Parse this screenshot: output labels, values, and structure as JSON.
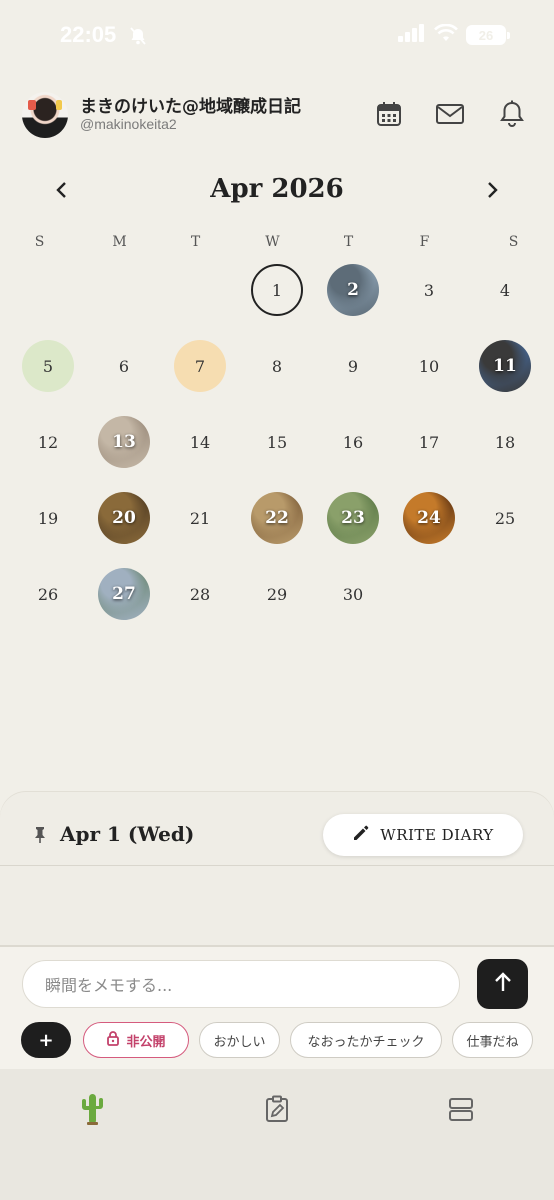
{
  "status_bar": {
    "time": "22:05",
    "battery": "26"
  },
  "profile": {
    "name": "まきのけいた@地域醸成日記",
    "handle": "@makinokeita2"
  },
  "calendar": {
    "month_title": "Apr 2026",
    "weekdays": [
      "S",
      "M",
      "T",
      "W",
      "T",
      "F",
      "S"
    ],
    "weeks": [
      [
        null,
        null,
        null,
        {
          "day": "1",
          "style": "today"
        },
        {
          "day": "2",
          "style": "photo",
          "photo_colors": [
            "#9fb6c9",
            "#5d6c78"
          ]
        },
        {
          "day": "3"
        },
        {
          "day": "4"
        }
      ],
      [
        {
          "day": "5",
          "style": "green"
        },
        {
          "day": "6"
        },
        {
          "day": "7",
          "style": "orange"
        },
        {
          "day": "8"
        },
        {
          "day": "9"
        },
        {
          "day": "10"
        },
        {
          "day": "11",
          "style": "photo",
          "photo_colors": [
            "#4a78b7",
            "#3a3a3a"
          ]
        }
      ],
      [
        {
          "day": "12"
        },
        {
          "day": "13",
          "style": "photo",
          "photo_colors": [
            "#8a7a6a",
            "#c4b7a6"
          ]
        },
        {
          "day": "14"
        },
        {
          "day": "15"
        },
        {
          "day": "16"
        },
        {
          "day": "17"
        },
        {
          "day": "18"
        }
      ],
      [
        {
          "day": "19"
        },
        {
          "day": "20",
          "style": "photo",
          "photo_colors": [
            "#3a2a1a",
            "#8a6a3a"
          ]
        },
        {
          "day": "21"
        },
        {
          "day": "22",
          "style": "photo",
          "photo_colors": [
            "#6a4a2a",
            "#b89a6a"
          ]
        },
        {
          "day": "23",
          "style": "photo",
          "photo_colors": [
            "#4a6a3a",
            "#8aa06a"
          ]
        },
        {
          "day": "24",
          "style": "photo",
          "photo_colors": [
            "#3a1a0a",
            "#c47a2a"
          ]
        },
        {
          "day": "25"
        }
      ],
      [
        {
          "day": "26"
        },
        {
          "day": "27",
          "style": "photo",
          "photo_colors": [
            "#5a7a5a",
            "#a0b0c0"
          ]
        },
        {
          "day": "28"
        },
        {
          "day": "29"
        },
        {
          "day": "30"
        },
        null,
        null
      ]
    ]
  },
  "selected": {
    "date_label": "Apr 1 (Wed)",
    "write_button": "WRITE DIARY"
  },
  "composer": {
    "placeholder": "瞬間をメモする...",
    "add_label": "+",
    "chips": [
      "非公開",
      "おかしい",
      "なおったかチェック",
      "仕事だね"
    ]
  },
  "colors": {
    "background": "#F1EFE8",
    "today_ring": "#222222",
    "green_mark": "#DCE8C9",
    "orange_mark": "#F6DDB1",
    "private_chip": "#C3426B",
    "send_button": "#1E1E1E"
  },
  "icons": {
    "header": [
      "calendar-icon",
      "mail-icon",
      "bell-icon"
    ],
    "tabs": [
      "cactus-icon",
      "edit-icon",
      "list-icon"
    ]
  }
}
